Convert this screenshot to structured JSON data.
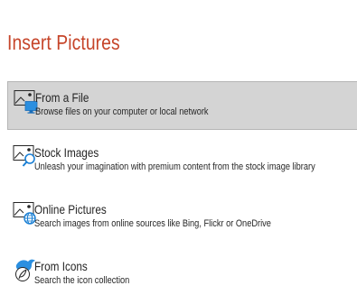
{
  "dialog": {
    "title": "Insert Pictures",
    "accent_color": "#c6452a",
    "options": [
      {
        "label": "From a File",
        "description": "Browse files on your computer or local network",
        "icon": "file-picture-icon",
        "selected": true
      },
      {
        "label": "Stock Images",
        "description": "Unleash your imagination with premium content from the stock image library",
        "icon": "stock-images-icon",
        "selected": false
      },
      {
        "label": "Online Pictures",
        "description": "Search images from online sources like Bing, Flickr or OneDrive",
        "icon": "online-pictures-icon",
        "selected": false
      },
      {
        "label": "From Icons",
        "description": "Search the icon collection",
        "icon": "icons-bird-icon",
        "selected": false
      }
    ]
  }
}
